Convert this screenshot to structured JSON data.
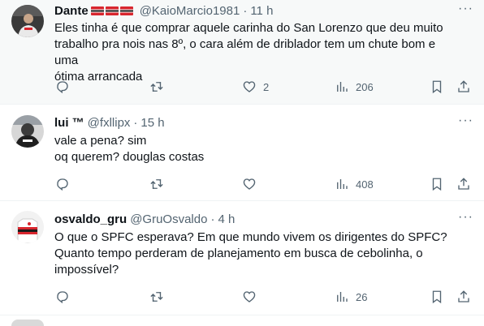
{
  "tweets": [
    {
      "name": "Dante",
      "handle": "@KaioMarcio1981",
      "time": "11 h",
      "text_lines": [
        "Eles tinha é que comprar aquele carinha do San Lorenzo que deu muito",
        "trabalho pra nois nas 8º, o cara além de driblador tem um chute bom e uma",
        "ótima arrancada"
      ],
      "likes": "2",
      "views": "206"
    },
    {
      "name": "lui ™",
      "handle": "@fxllipx",
      "time": "15 h",
      "text_lines": [
        "vale a pena? sim",
        "oq querem? douglas costas"
      ],
      "views": "408"
    },
    {
      "name": "osvaldo_gru",
      "handle": "@GruOsvaldo",
      "time": "4 h",
      "text_lines": [
        "O que o SPFC esperava? Em que mundo vivem os dirigentes do SPFC?",
        "Quanto tempo perderam de planejamento em busca de cebolinha, o",
        "impossível?"
      ],
      "views": "26"
    }
  ],
  "separator": "·",
  "icons": {
    "reply": "reply-icon",
    "retweet": "retweet-icon",
    "like": "heart-icon",
    "views": "views-bar-chart-icon",
    "bookmark": "bookmark-icon",
    "share": "share-icon",
    "more": "more-dots-icon"
  },
  "colors": {
    "highlight_bg": "#f7f9f9",
    "muted_text": "#536471",
    "flag_red": "#d8262e",
    "flag_black": "#1a1a1a"
  }
}
